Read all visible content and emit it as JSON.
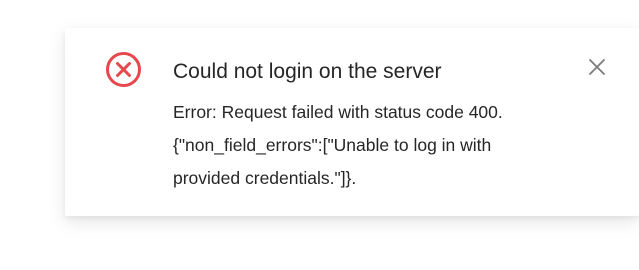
{
  "notification": {
    "type": "error",
    "icon": "error-circle-x-icon",
    "close_icon": "close-icon",
    "accent_color": "#e5484d",
    "title": "Could not login on the server",
    "message_lines": [
      "Error: Request failed with status code 400.",
      "{\"non_field_errors\":[\"Unable to log in with",
      "provided credentials.\"]}."
    ]
  }
}
